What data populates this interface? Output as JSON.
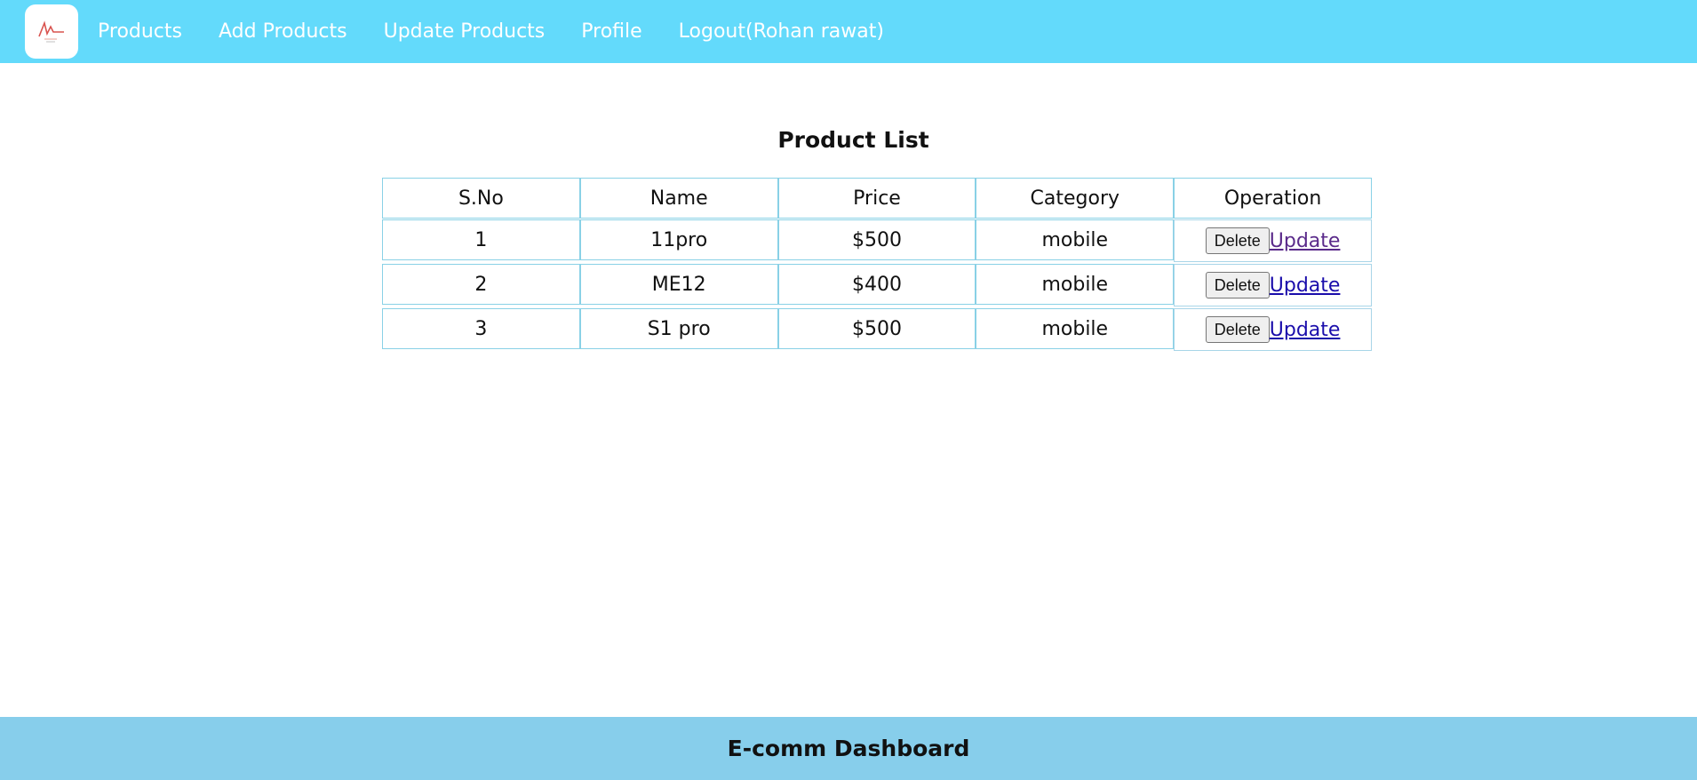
{
  "nav": {
    "links": [
      {
        "label": "Products"
      },
      {
        "label": "Add Products"
      },
      {
        "label": "Update Products"
      },
      {
        "label": "Profile"
      },
      {
        "label": "Logout(Rohan rawat)"
      }
    ],
    "colors": {
      "background": "#63dafb",
      "text": "#ffffff"
    }
  },
  "main": {
    "title": "Product List",
    "table": {
      "headers": [
        "S.No",
        "Name",
        "Price",
        "Category",
        "Operation"
      ],
      "rows": [
        {
          "sno": "1",
          "name": "11pro",
          "price": "$500",
          "category": "mobile"
        },
        {
          "sno": "2",
          "name": "ME12",
          "price": "$400",
          "category": "mobile"
        },
        {
          "sno": "3",
          "name": "S1 pro",
          "price": "$500",
          "category": "mobile"
        }
      ],
      "delete_label": "Delete",
      "update_label": "Update",
      "border_color": "#89d1e6"
    }
  },
  "footer": {
    "text": "E-comm Dashboard",
    "background": "#87ceeb"
  }
}
